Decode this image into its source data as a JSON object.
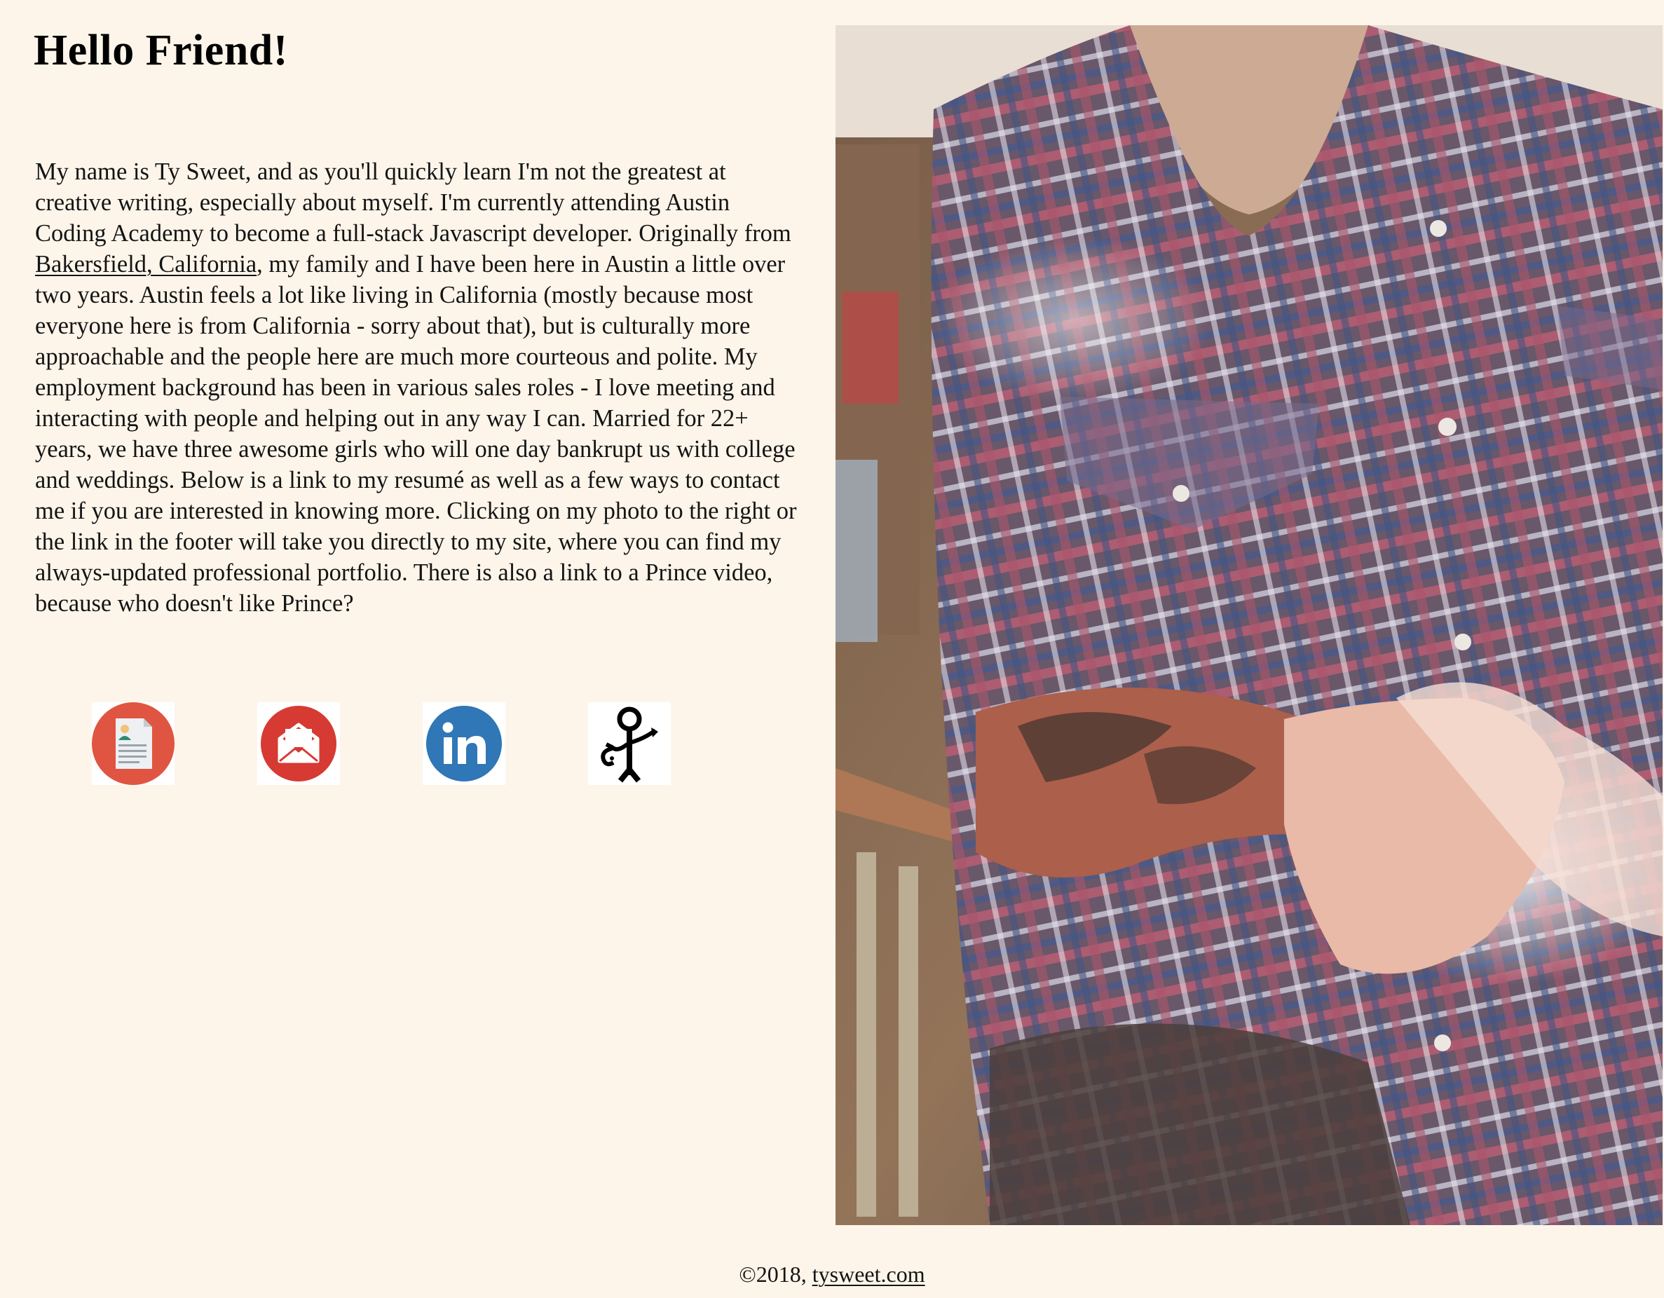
{
  "heading": "Hello Friend!",
  "bio": {
    "before_link": "My name is Ty Sweet, and as you'll quickly learn I'm not the greatest at creative writing, especially about myself. I'm currently attending Austin Coding Academy to become a full-stack Javascript developer. Originally from ",
    "link_text": "Bakersfield, California",
    "after_link": ", my family and I have been here in Austin a little over two years. Austin feels a lot like living in California (mostly because most everyone here is from California - sorry about that), but is culturally more approachable and the people here are much more courteous and polite. My employment background has been in various sales roles - I love meeting and interacting with people and helping out in any way I can. Married for 22+ years, we have three awesome girls who will one day bankrupt us with college and weddings. Below is a link to my resumé as well as a few ways to contact me if you are interested in knowing more. Clicking on my photo to the right or the link in the footer will take you directly to my site, where you can find my always-updated professional portfolio. There is also a link to a Prince video, because who doesn't like Prince?"
  },
  "icons": [
    {
      "name": "resume-icon",
      "color": "#e05541"
    },
    {
      "name": "email-icon",
      "color": "#d63a32"
    },
    {
      "name": "linkedin-icon",
      "color": "#2f77b6"
    },
    {
      "name": "prince-symbol-icon",
      "color": "#000000"
    }
  ],
  "photo": {
    "subject": "plaid-shirt-portrait"
  },
  "footer": {
    "copyright": "©2018, ",
    "link_text": "tysweet.com"
  },
  "colors": {
    "background": "#fdf5ea",
    "text": "#141414"
  }
}
